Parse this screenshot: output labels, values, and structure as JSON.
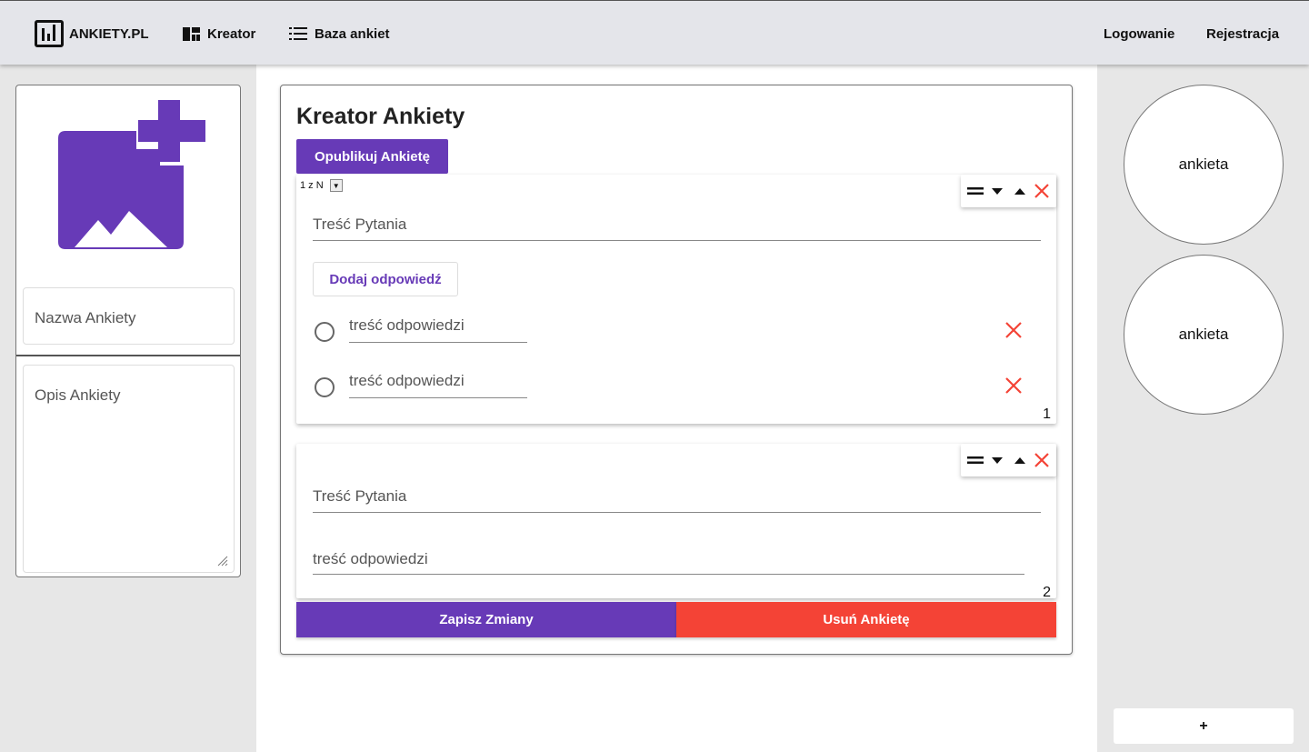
{
  "nav": {
    "brand": "ANKIETY.PL",
    "kreator": "Kreator",
    "baza": "Baza ankiet",
    "login": "Logowanie",
    "register": "Rejestracja"
  },
  "left": {
    "image_icon": "add-photo-icon",
    "name_placeholder": "Nazwa Ankiety",
    "desc_placeholder": "Opis Ankiety"
  },
  "editor": {
    "title": "Kreator Ankiety",
    "publish": "Opublikuj Ankietę",
    "questions": [
      {
        "type": "1 z N",
        "title_placeholder": "Treść Pytania",
        "add_answer": "Dodaj odpowiedź",
        "answers": [
          "treść odpowiedzi",
          "treść odpowiedzi"
        ],
        "number": "1"
      },
      {
        "title_placeholder": "Treść Pytania",
        "answer_placeholder": "treść odpowiedzi",
        "number": "2"
      }
    ],
    "save": "Zapisz Zmiany",
    "delete": "Usuń Ankietę"
  },
  "right": {
    "surveys": [
      "ankieta",
      "ankieta"
    ],
    "add": "+"
  },
  "colors": {
    "primary": "#673ab7",
    "danger": "#f44336",
    "topbar": "#e4e5ea",
    "side": "#e7e7e7"
  }
}
